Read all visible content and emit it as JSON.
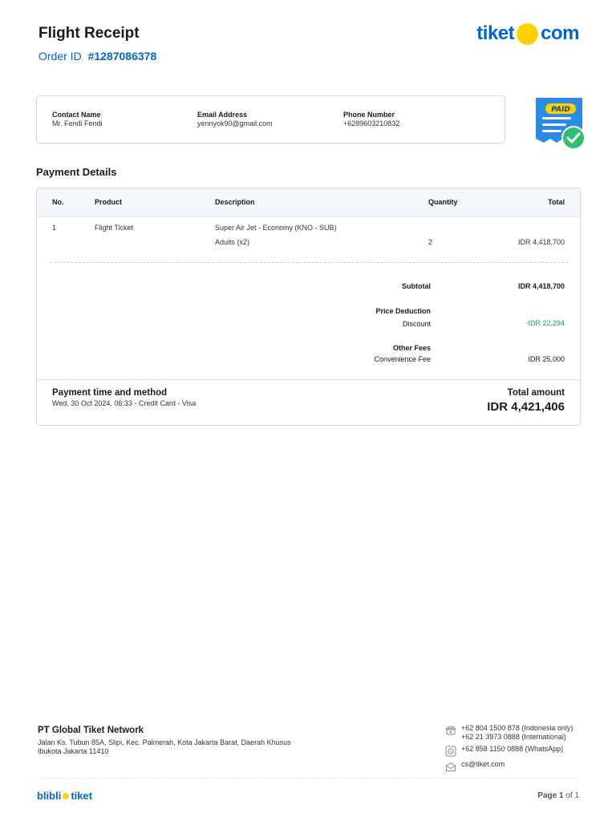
{
  "header": {
    "title": "Flight Receipt",
    "order_label": "Order ID",
    "order_id": "#1287086378",
    "logo_left": "tiket",
    "logo_right": "com"
  },
  "contact": {
    "name_label": "Contact Name",
    "name_value": "Mr. Fendi Fendi",
    "email_label": "Email Address",
    "email_value": "yennyok90@gmail.com",
    "phone_label": "Phone Number",
    "phone_value": "+6289603210832"
  },
  "badge": {
    "text": "PAID",
    "icon": "paid-receipt-icon"
  },
  "payment": {
    "section_title": "Payment Details",
    "columns": [
      "No.",
      "Product",
      "Description",
      "Quantity",
      "Total"
    ],
    "row": {
      "no": "1",
      "product": "Flight Ticket",
      "description": "Super Air Jet - Economy (KNO - SUB)",
      "sub_description": "Adults (x2)",
      "quantity": "2",
      "total": "IDR 4,418,700"
    },
    "subtotal_label": "Subtotal",
    "subtotal_value": "IDR 4,418,700",
    "deduction_title": "Price Deduction",
    "discount_label": "Discount",
    "discount_value": "-IDR 22,294",
    "other_fees_title": "Other Fees",
    "convenience_label": "Convenience Fee",
    "convenience_value": "IDR 25,000",
    "method_title": "Payment time and method",
    "method_value": "Wed, 30 Oct 2024, 06:33 - Credit Card - Visa",
    "total_label": "Total amount",
    "total_value": "IDR 4,421,406"
  },
  "footer": {
    "company": "PT Global Tiket Network",
    "address": "Jalan Ks. Tubun 85A, Slipi, Kec. Palmerah, Kota Jakarta Barat, Daerah Khusus Ibukota Jakarta 11410",
    "phone_1": "+62 804 1500 878 (Indonesia only)",
    "phone_2": "+62 21 3973 0888 (International)",
    "whatsapp": "+62 858 1150 0888 (WhatsApp)",
    "email": "cs@tiket.com",
    "brand_left": "blibli",
    "brand_right": "tiket",
    "page_word": "Page",
    "page_current": "1",
    "page_of": "of",
    "page_total": "1"
  },
  "colors": {
    "brand_blue": "#0064d2",
    "brand_yellow": "#ffd100",
    "discount_green": "#0e9f5a"
  }
}
